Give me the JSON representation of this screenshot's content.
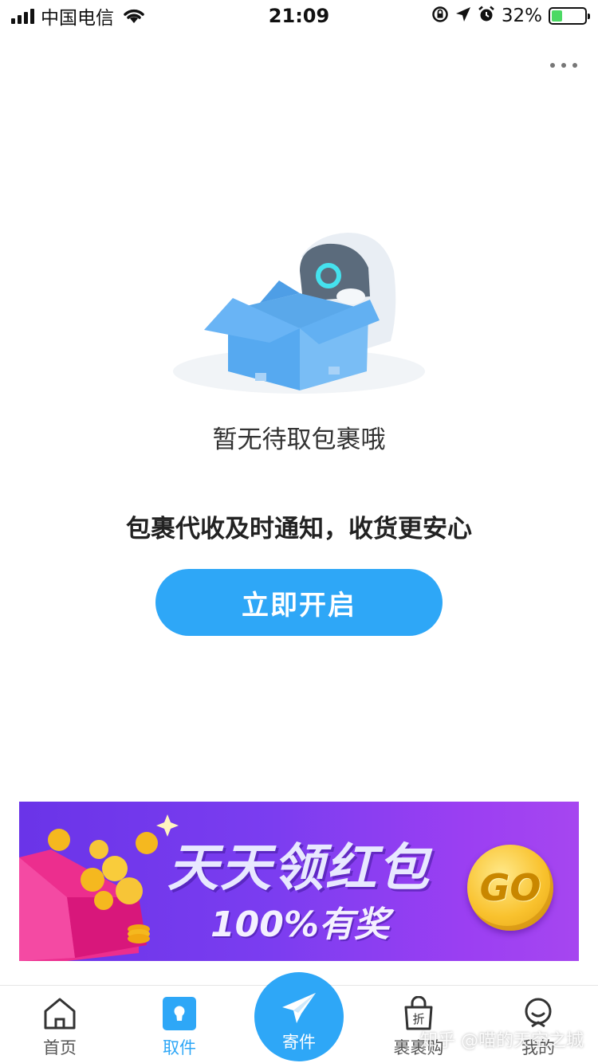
{
  "status_bar": {
    "carrier": "中国电信",
    "time": "21:09",
    "battery_pct": "32%",
    "battery_level": 0.32,
    "icons": [
      "signal-icon",
      "wifi-icon",
      "orientation-lock-icon",
      "location-icon",
      "alarm-icon",
      "battery-icon"
    ]
  },
  "header": {
    "more_icon": "more-icon"
  },
  "empty_state": {
    "message": "暂无待取包裹哦",
    "illustration": "robot-box-illustration"
  },
  "promo": {
    "text": "包裹代收及时通知，收货更安心",
    "button_label": "立即开启"
  },
  "banner": {
    "title": "天天领红包",
    "subtitle": "100%有奖",
    "go_label": "GO",
    "colors": {
      "start": "#6a34e8",
      "end": "#a646f0"
    }
  },
  "tab_bar": {
    "items": [
      {
        "label": "首页",
        "icon": "home-icon"
      },
      {
        "label": "取件",
        "icon": "pickup-icon",
        "active": true
      },
      {
        "label": "寄件",
        "icon": "send-icon"
      },
      {
        "label": "裹裹购",
        "icon": "discount-bag-icon"
      },
      {
        "label": "我的",
        "icon": "profile-icon"
      }
    ]
  },
  "watermark": "知乎 @喵的天空之城",
  "colors": {
    "accent": "#2ea7f7"
  }
}
